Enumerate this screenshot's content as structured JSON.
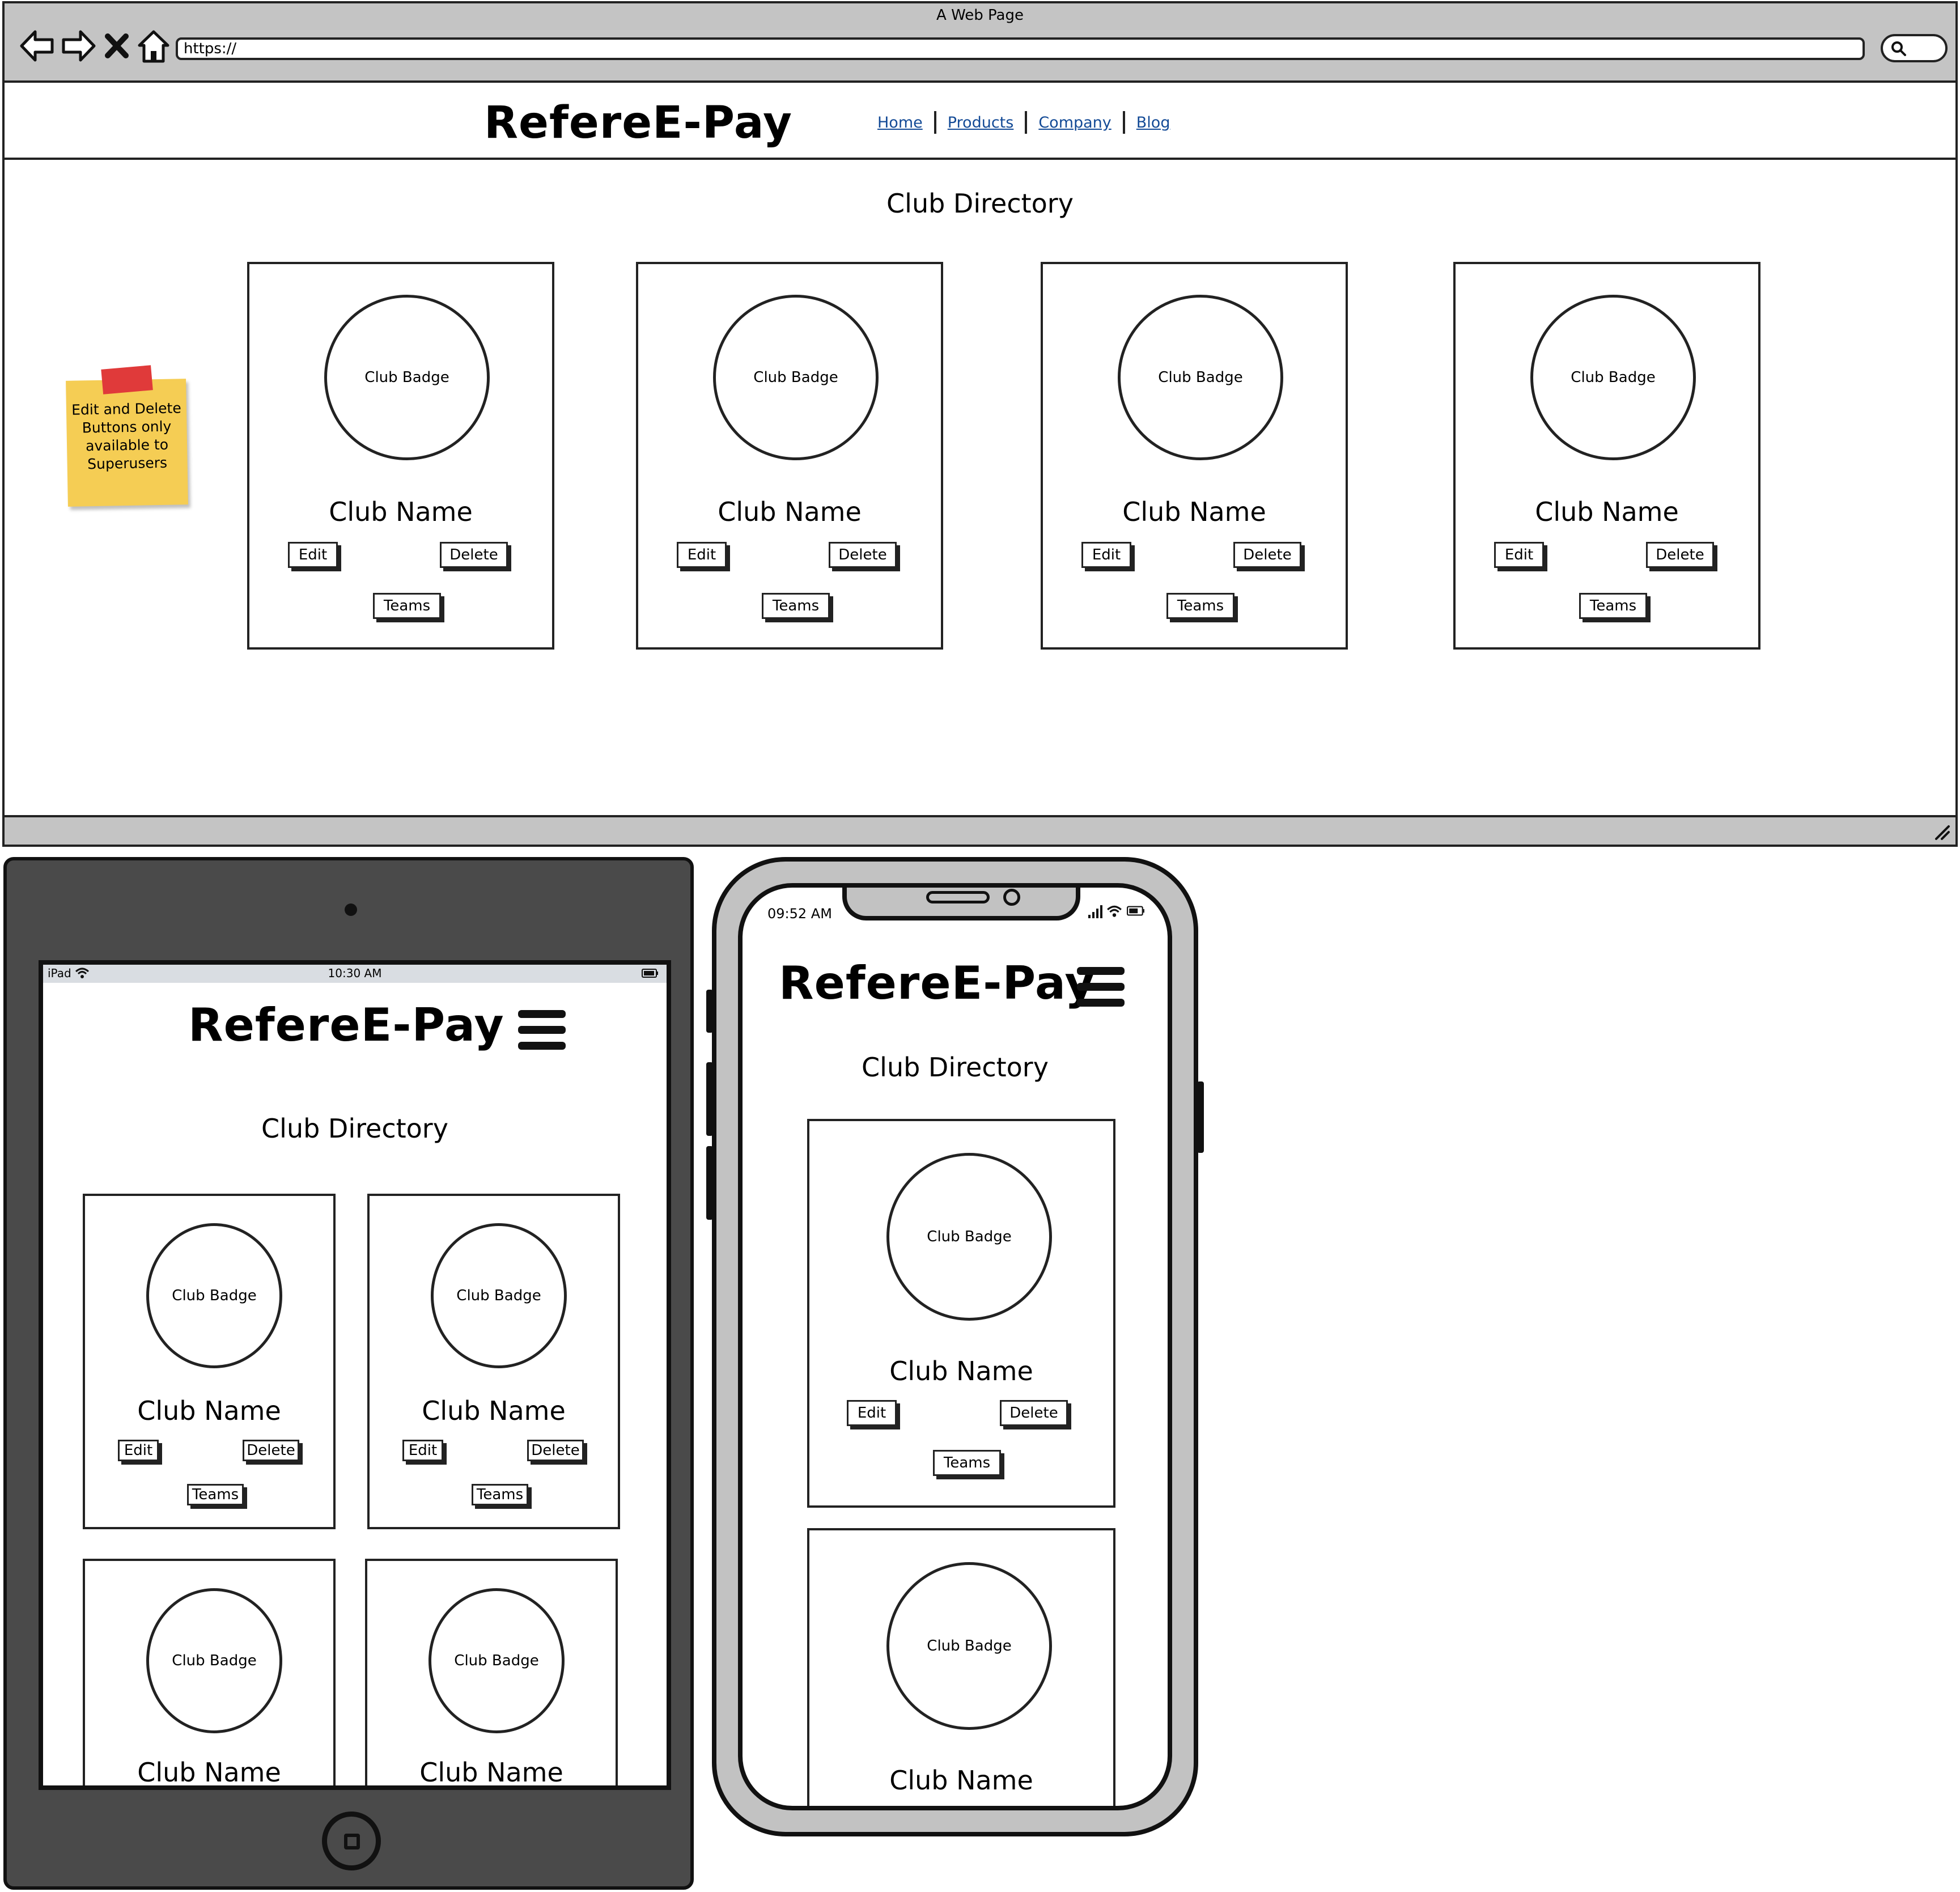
{
  "browser": {
    "window_title": "A Web Page",
    "url": "https://",
    "brand": "RefereE-Pay",
    "nav": [
      "Home",
      "Products",
      "Company",
      "Blog"
    ],
    "heading": "Club Directory",
    "sticky_note": "Edit and Delete Buttons only available to Superusers"
  },
  "club_card": {
    "badge": "Club Badge",
    "name": "Club Name",
    "edit_label": "Edit",
    "delete_label": "Delete",
    "teams_label": "Teams"
  },
  "tablet": {
    "status_device": "iPad",
    "status_time": "10:30 AM",
    "brand": "RefereE-Pay",
    "heading": "Club Directory"
  },
  "phone": {
    "status_time": "09:52 AM",
    "brand": "RefereE-Pay",
    "heading": "Club Directory"
  },
  "colors": {
    "chrome_gray": "#c4c4c4",
    "link_blue": "#134a96",
    "sticky_yellow": "#f5cd54",
    "sticky_tape_red": "#e03a3a",
    "tablet_body": "#4a4a4a"
  }
}
